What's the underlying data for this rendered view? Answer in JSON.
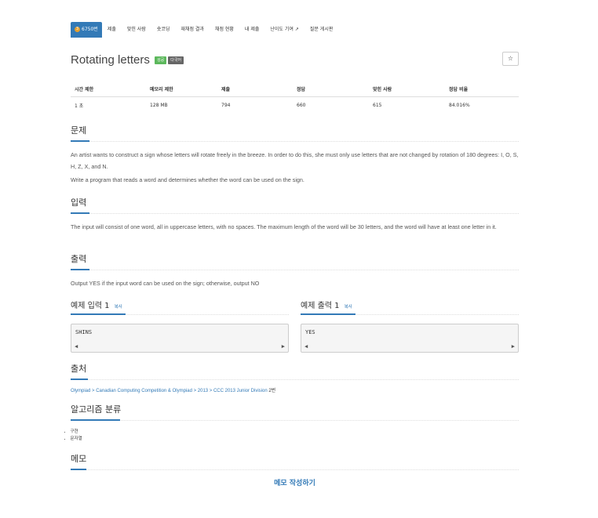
{
  "tabs": [
    {
      "label": "6750번",
      "active": true,
      "medal": "3"
    },
    {
      "label": "제출"
    },
    {
      "label": "맞힌 사람"
    },
    {
      "label": "숏코딩"
    },
    {
      "label": "재채점 결과"
    },
    {
      "label": "채점 현황"
    },
    {
      "label": "내 제출"
    },
    {
      "label": "난이도 기여"
    },
    {
      "label": "질문 게시판"
    }
  ],
  "problem": {
    "title": "Rotating letters",
    "badge_success": "성공",
    "badge_lang": "다국어",
    "star": "☆"
  },
  "stats": {
    "headers": [
      "시간 제한",
      "메모리 제한",
      "제출",
      "정답",
      "맞힌 사람",
      "정답 비율"
    ],
    "values": [
      "1 초",
      "128 MB",
      "794",
      "660",
      "615",
      "84.016%"
    ]
  },
  "sections": {
    "problem_h": "문제",
    "problem_p1": "An artist wants to construct a sign whose letters will rotate freely in the breeze. In order to do this, she must only use letters that are not changed by rotation of 180 degrees: I, O, S, H, Z, X, and N.",
    "problem_p2": "Write a program that reads a word and determines whether the word can be used on the sign.",
    "input_h": "입력",
    "input_p": "The input will consist of one word, all in uppercase letters, with no spaces. The maximum length of the word will be 30 letters, and the word will have at least one letter in it.",
    "output_h": "출력",
    "output_p": "Output YES if the input word can be used on the sign; otherwise, output NO",
    "source_h": "출처",
    "algo_h": "알고리즘 분류",
    "memo_h": "메모"
  },
  "samples": {
    "input_h": "예제 입력",
    "input_num": "1",
    "output_h": "예제 출력",
    "output_num": "1",
    "copy": "복사",
    "input_text": "SHINS",
    "output_text": "YES"
  },
  "source": {
    "link1": "Olympiad",
    "sep1": " > ",
    "link2": "Canadian Computing Competition & Olympiad",
    "sep2": " > ",
    "link3": "2013",
    "sep3": " > ",
    "link4": "CCC 2013 Junior Division",
    "suffix": " 2번"
  },
  "algorithms": [
    "구현",
    "문자열"
  ],
  "memo_button": "메모 작성하기"
}
